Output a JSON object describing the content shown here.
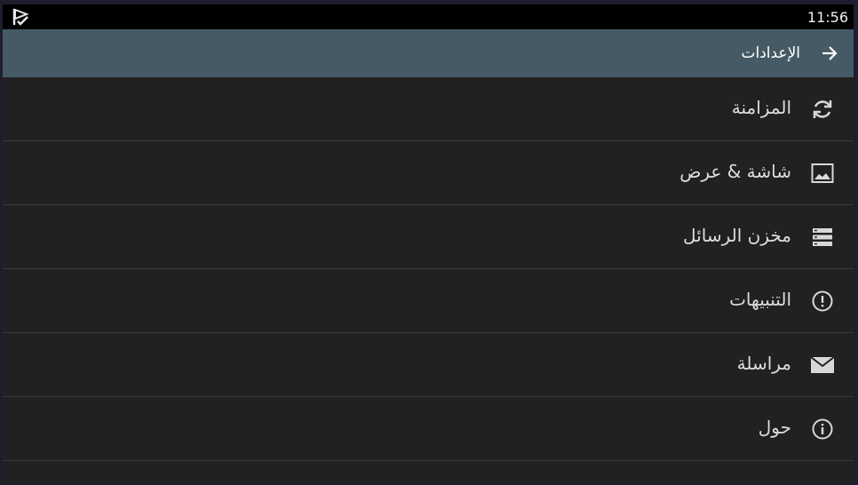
{
  "status_bar": {
    "time": "11:56",
    "app_icon": "flag-check-icon"
  },
  "app_bar": {
    "title": "الإعدادات",
    "back_icon": "arrow-right-icon"
  },
  "settings_items": [
    {
      "label": "المزامنة",
      "icon": "sync-icon"
    },
    {
      "label": "شاشة & عرض",
      "icon": "image-icon"
    },
    {
      "label": "مخزن الرسائل",
      "icon": "storage-icon"
    },
    {
      "label": "التنبيهات",
      "icon": "alert-icon"
    },
    {
      "label": "مراسلة",
      "icon": "mail-icon"
    },
    {
      "label": "حول",
      "icon": "info-icon"
    }
  ],
  "colors": {
    "app_bar": "#455a64",
    "background": "#212121",
    "status_bar": "#000000"
  }
}
